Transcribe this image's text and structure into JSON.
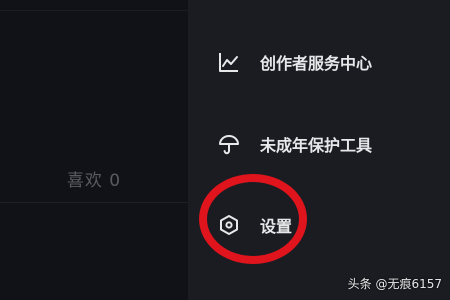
{
  "profile": {
    "likes_label": "喜欢 0"
  },
  "drawer": {
    "items": [
      {
        "label": "创作者服务中心",
        "icon": "chart-line-icon"
      },
      {
        "label": "未成年保护工具",
        "icon": "umbrella-icon"
      },
      {
        "label": "设置",
        "icon": "hexagon-settings-icon"
      }
    ]
  },
  "watermark": "头条 @无痕6157",
  "colors": {
    "highlight": "#e0141c",
    "drawer_bg": "#1b1c22",
    "left_bg": "#111217",
    "text": "#e8e8ea"
  }
}
